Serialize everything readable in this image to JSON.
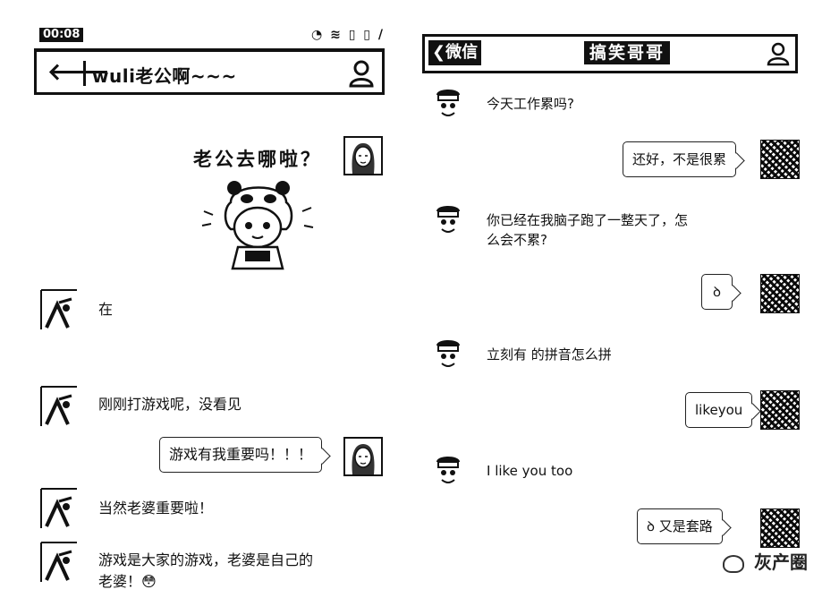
{
  "left": {
    "status_time": "00:08",
    "status_icons": "◔ ≋ ▯ ▯ /",
    "back_arrow": "🡐",
    "contact_name": "wuli老公啊~~~",
    "sticker_caption": "老公去哪啦？",
    "messages": [
      {
        "side": "in",
        "text": "在"
      },
      {
        "side": "in",
        "text": "刚刚打游戏呢，没看见"
      },
      {
        "side": "out",
        "text": "游戏有我重要吗！！！"
      },
      {
        "side": "in",
        "text": "当然老婆重要啦！"
      },
      {
        "side": "in",
        "text": "游戏是大家的游戏，老婆是自己的",
        "text2": "老婆！😳"
      }
    ]
  },
  "right": {
    "back_label": "❮微信",
    "contact_name": "搞笑哥哥",
    "messages": [
      {
        "side": "in",
        "text": "今天工作累吗?"
      },
      {
        "side": "out",
        "text": "还好，不是很累"
      },
      {
        "side": "in",
        "text": "你已经在我脑子跑了一整天了，怎",
        "text2": "么会不累?"
      },
      {
        "side": "out",
        "text": "ꝺ"
      },
      {
        "side": "in",
        "text": "立刻有 的拼音怎么拼"
      },
      {
        "side": "out",
        "text": "likeyou"
      },
      {
        "side": "in",
        "text": "I like you too"
      },
      {
        "side": "out",
        "text": "又是套路",
        "prefix": "ꝺ"
      }
    ]
  },
  "watermark": "灰产圈",
  "icons": {
    "person": "person-icon",
    "back": "back-arrow-icon",
    "signal": "status-icons"
  }
}
